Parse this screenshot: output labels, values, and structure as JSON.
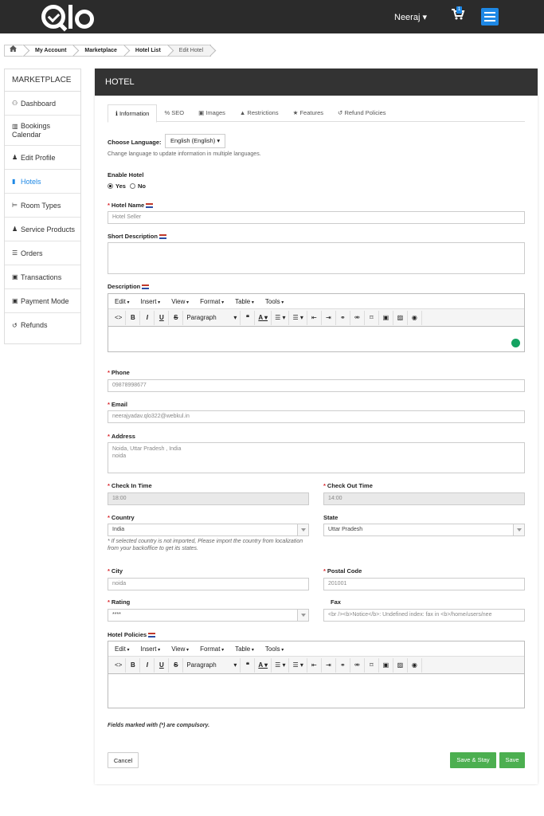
{
  "topbar": {
    "user_label": "Neeraj ▾",
    "cart_count": "1"
  },
  "breadcrumb": {
    "items": [
      "My Account",
      "Marketplace",
      "Hotel List",
      "Edit Hotel"
    ]
  },
  "sidebar": {
    "title": "MARKETPLACE",
    "items": [
      {
        "label": "Dashboard",
        "icon": "dashboard-icon",
        "glyph": "⚇"
      },
      {
        "label": "Bookings Calendar",
        "icon": "chart-icon",
        "glyph": "▥"
      },
      {
        "label": "Edit Profile",
        "icon": "user-icon",
        "glyph": "♟"
      },
      {
        "label": "Hotels",
        "icon": "building-icon",
        "glyph": "▮"
      },
      {
        "label": "Room Types",
        "icon": "bed-icon",
        "glyph": "⊨"
      },
      {
        "label": "Service Products",
        "icon": "users-icon",
        "glyph": "♟"
      },
      {
        "label": "Orders",
        "icon": "orders-icon",
        "glyph": "☰"
      },
      {
        "label": "Transactions",
        "icon": "transactions-icon",
        "glyph": "▣"
      },
      {
        "label": "Payment Mode",
        "icon": "payment-icon",
        "glyph": "▣"
      },
      {
        "label": "Refunds",
        "icon": "refund-icon",
        "glyph": "↺"
      }
    ]
  },
  "card": {
    "title": "HOTEL",
    "tabs": [
      {
        "label": "Information",
        "glyph": "ℹ"
      },
      {
        "label": "SEO",
        "glyph": "%"
      },
      {
        "label": "Images",
        "glyph": "▣"
      },
      {
        "label": "Restrictions",
        "glyph": "▲"
      },
      {
        "label": "Features",
        "glyph": "★"
      },
      {
        "label": "Refund Policies",
        "glyph": "↺"
      }
    ]
  },
  "form": {
    "language_label": "Choose Language:",
    "language_value": "English (English) ▾",
    "language_help": "Change language to update information in multiple languages.",
    "enable_label": "Enable Hotel",
    "enable_yes": "Yes",
    "enable_no": "No",
    "hotel_name_label": "Hotel Name",
    "hotel_name_value": "Hotel Seller",
    "short_desc_label": "Short Description",
    "description_label": "Description",
    "phone_label": "Phone",
    "phone_value": "09878998677",
    "email_label": "Email",
    "email_value": "neerajyadav.qlo322@webkul.in",
    "address_label": "Address",
    "address_value": "Noida, Uttar Pradesh , India\nnoida",
    "checkin_label": "Check In Time",
    "checkin_value": "18:00",
    "checkout_label": "Check Out Time",
    "checkout_value": "14:00",
    "country_label": "Country",
    "country_value": "India",
    "country_help": "* If selected country is not imported, Please import the country from localization from your backoffice to get its states.",
    "state_label": "State",
    "state_value": "Uttar Pradesh",
    "city_label": "City",
    "city_value": "noida",
    "postal_label": "Postal Code",
    "postal_value": "201001",
    "rating_label": "Rating",
    "rating_value": "****",
    "fax_label": "Fax",
    "fax_value": "<br /><b>Notice</b>:  Undefined index: fax in <b>/home/users/nee",
    "policies_label": "Hotel Policies",
    "required_note": "Fields marked with (*) are compulsory.",
    "cancel_label": "Cancel",
    "save_stay_label": "Save & Stay",
    "save_label": "Save"
  },
  "editor": {
    "menus": [
      "Edit",
      "Insert",
      "View",
      "Format",
      "Table",
      "Tools"
    ],
    "paragraph_label": "Paragraph"
  }
}
